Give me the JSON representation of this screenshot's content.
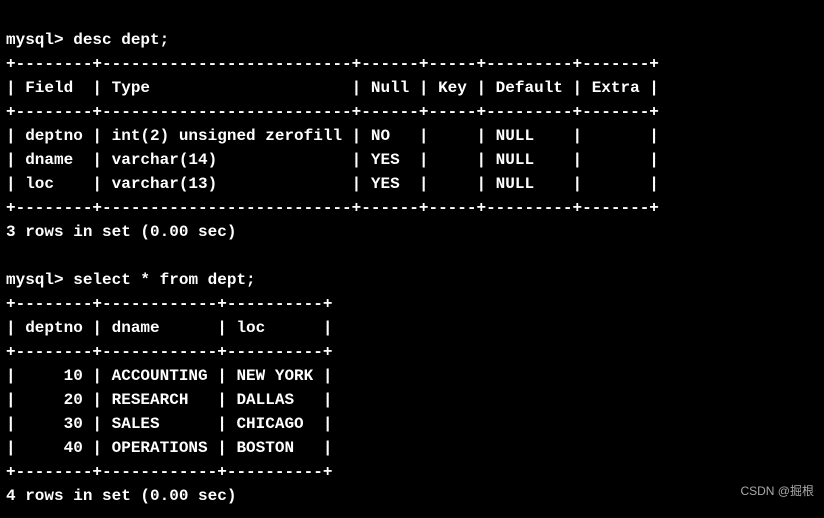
{
  "prompt": "mysql>",
  "command1": "desc dept;",
  "desc": {
    "border_top": "+--------+--------------------------+------+-----+---------+-------+",
    "header": "| Field  | Type                     | Null | Key | Default | Extra |",
    "border_mid": "+--------+--------------------------+------+-----+---------+-------+",
    "row1": "| deptno | int(2) unsigned zerofill | NO   |     | NULL    |       |",
    "row2": "| dname  | varchar(14)              | YES  |     | NULL    |       |",
    "row3": "| loc    | varchar(13)              | YES  |     | NULL    |       |",
    "border_bot": "+--------+--------------------------+------+-----+---------+-------+",
    "summary": "3 rows in set (0.00 sec)"
  },
  "command2": "select * from dept;",
  "sel": {
    "border_top": "+--------+------------+----------+",
    "header": "| deptno | dname      | loc      |",
    "border_mid": "+--------+------------+----------+",
    "row1": "|     10 | ACCOUNTING | NEW YORK |",
    "row2": "|     20 | RESEARCH   | DALLAS   |",
    "row3": "|     30 | SALES      | CHICAGO  |",
    "row4": "|     40 | OPERATIONS | BOSTON   |",
    "border_bot": "+--------+------------+----------+",
    "summary": "4 rows in set (0.00 sec)"
  },
  "chart_data": {
    "type": "table",
    "tables": [
      {
        "title": "desc dept",
        "columns": [
          "Field",
          "Type",
          "Null",
          "Key",
          "Default",
          "Extra"
        ],
        "rows": [
          [
            "deptno",
            "int(2) unsigned zerofill",
            "NO",
            "",
            "NULL",
            ""
          ],
          [
            "dname",
            "varchar(14)",
            "YES",
            "",
            "NULL",
            ""
          ],
          [
            "loc",
            "varchar(13)",
            "YES",
            "",
            "NULL",
            ""
          ]
        ]
      },
      {
        "title": "select * from dept",
        "columns": [
          "deptno",
          "dname",
          "loc"
        ],
        "rows": [
          [
            10,
            "ACCOUNTING",
            "NEW YORK"
          ],
          [
            20,
            "RESEARCH",
            "DALLAS"
          ],
          [
            30,
            "SALES",
            "CHICAGO"
          ],
          [
            40,
            "OPERATIONS",
            "BOSTON"
          ]
        ]
      }
    ]
  },
  "watermark": "CSDN @掘根"
}
